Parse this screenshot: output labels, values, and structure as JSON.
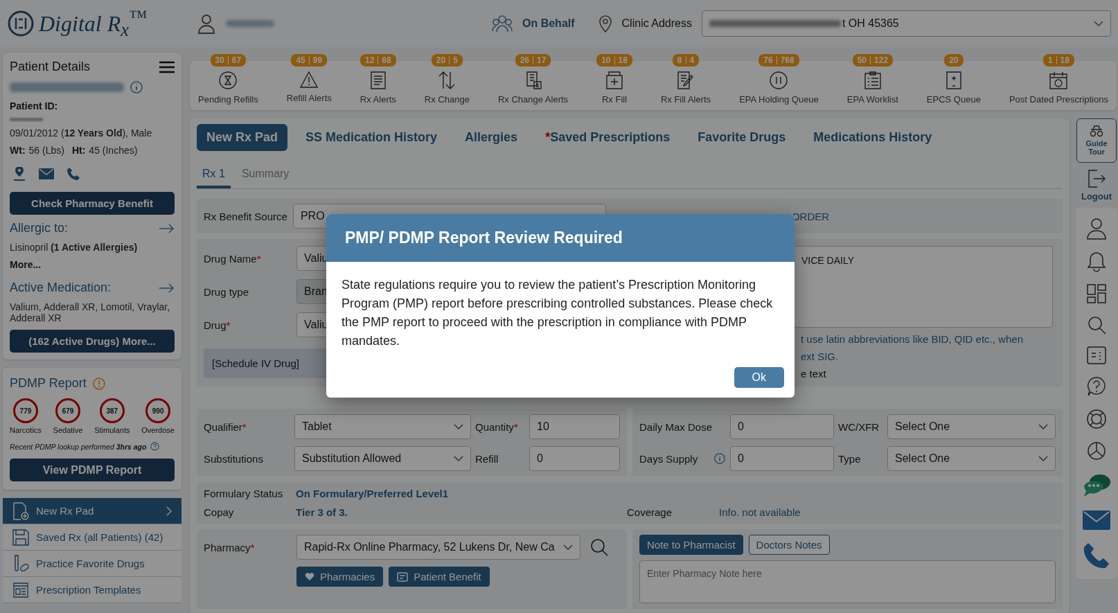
{
  "header": {
    "logo": "Digital R$_{x}$$^{™}$",
    "on_behalf": "On Behalf",
    "clinic_address_label": "Clinic Address",
    "clinic_address_value": "t OH 45365"
  },
  "toolbar": [
    {
      "label": "Pending Refills",
      "counts": [
        "30",
        "67"
      ]
    },
    {
      "label": "Refill Alerts",
      "counts": [
        "45",
        "99"
      ]
    },
    {
      "label": "Rx Alerts",
      "counts": [
        "12",
        "68"
      ]
    },
    {
      "label": "Rx Change",
      "counts": [
        "20",
        "5"
      ]
    },
    {
      "label": "Rx Change Alerts",
      "counts": [
        "26",
        "17"
      ]
    },
    {
      "label": "Rx Fill",
      "counts": [
        "10",
        "18"
      ]
    },
    {
      "label": "Rx Fill Alerts",
      "counts": [
        "8",
        "4"
      ]
    },
    {
      "label": "EPA Holding Queue",
      "counts": [
        "76",
        "768"
      ]
    },
    {
      "label": "EPA Worklist",
      "counts": [
        "50",
        "122"
      ]
    },
    {
      "label": "EPCS Queue",
      "counts": [
        "20"
      ]
    },
    {
      "label": "Post Dated Prescriptions",
      "counts": [
        "1",
        "18"
      ]
    }
  ],
  "patient": {
    "title": "Patient Details",
    "id_label": "Patient ID:",
    "dob": "09/01/2012 (**12 Years Old**), Male",
    "weight_label": "Wt:",
    "weight": "56 (Lbs)",
    "height_label": "Ht:",
    "height": "45 (Inches)",
    "check_benefit": "Check Pharmacy Benefit",
    "allergic_title": "Allergic to:",
    "allergies": "Lisinopril **(1 Active Allergies)**",
    "allergies_more": "More...",
    "medication_title": "Active Medication:",
    "medications": "Valium, Adderall XR, Lomotil, Vraylar, Adderall XR",
    "medications_more": "(162 Active Drugs) More..."
  },
  "pdmp": {
    "title": "PDMP Report",
    "scores": [
      {
        "value": "779",
        "label": "Narcotics"
      },
      {
        "value": "679",
        "label": "Sedative"
      },
      {
        "value": "387",
        "label": "Stimulants"
      },
      {
        "value": "990",
        "label": "Overdose"
      }
    ],
    "lookup": "Recent PDMP lookup performed **3hrs ago**",
    "button": "View PDMP Report"
  },
  "nav": [
    {
      "label": "New Rx Pad",
      "selected": true
    },
    {
      "label": "Saved Rx (all Patients) (42)",
      "selected": false
    },
    {
      "label": "Practice Favorite Drugs",
      "selected": false
    },
    {
      "label": "Prescription Templates",
      "selected": false
    }
  ],
  "tabs": [
    {
      "label": "New Rx Pad",
      "selected": true
    },
    {
      "label": "SS Medication History",
      "selected": false
    },
    {
      "label": "Allergies",
      "selected": false
    },
    {
      "label": "Saved Prescriptions",
      "selected": false,
      "prefix": "*"
    },
    {
      "label": "Favorite Drugs",
      "selected": false
    },
    {
      "label": "Medications History",
      "selected": false
    }
  ],
  "subtabs": [
    {
      "label": "Rx 1",
      "selected": true
    },
    {
      "label": "Summary",
      "selected": false
    }
  ],
  "form": {
    "benefit_label": "Rx Benefit Source",
    "benefit_value": "PRO",
    "benefit_right": "ORDER",
    "drug_name_label": "Drug Name",
    "drug_name_value": "Valiu",
    "drug_type_label": "Drug type",
    "drug_type_value": "Bran",
    "drug_label": "Drug",
    "drug_value": "Valiu",
    "schedule": "[Schedule IV Drug]",
    "sig_value": "VICE DAILY",
    "sig_hint_1": "t use latin abbreviations like BID, QID etc., when",
    "sig_hint_2": "ext SIG.",
    "sig_hint_3": "e text",
    "qualifier_label": "Qualifier",
    "qualifier_value": "Tablet",
    "quantity_label": "Quantity",
    "quantity_value": "10",
    "substitutions_label": "Substitutions",
    "substitutions_value": "Substitution Allowed",
    "refill_label": "Refill",
    "refill_value": "0",
    "daily_max_label": "Daily Max Dose",
    "daily_max_value": "0",
    "days_supply_label": "Days Supply",
    "days_supply_value": "0",
    "wc_label": "WC/XFR",
    "wc_value": "Select One",
    "type_label": "Type",
    "type_value": "Select One",
    "formulary_label": "Formulary Status",
    "formulary_value": "On Formulary/Preferred Level1",
    "copay_label": "Copay",
    "copay_value": "Tier 3 of 3.",
    "coverage_label": "Coverage",
    "coverage_value": "Info. not available",
    "pharmacy_label": "Pharmacy",
    "pharmacy_value": "Rapid-Rx Online Pharmacy, 52 Lukens Dr, New Ca",
    "pharmacies_button": "Pharmacies",
    "patient_benefit_button": "Patient Benefit",
    "note_tabs": [
      {
        "label": "Note to Pharmacist",
        "selected": true
      },
      {
        "label": "Doctors Notes",
        "selected": false
      }
    ],
    "note_placeholder": "Enter Pharmacy Note here"
  },
  "rail": {
    "guide_tour": "Guide Tour",
    "logout": "Logout"
  },
  "modal": {
    "title": "PMP/ PDMP Report Review Required",
    "body": "State regulations require you to review the patient’s Prescription Monitoring Program (PMP) report before prescribing controlled substances. Please check the PMP report to proceed with the prescription in compliance with PDMP mandates.",
    "ok": "Ok"
  }
}
